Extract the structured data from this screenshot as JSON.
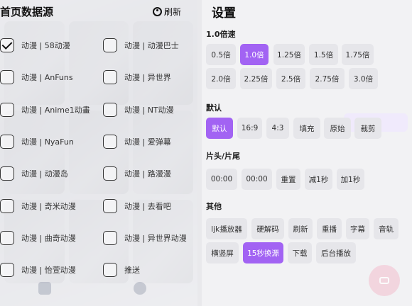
{
  "sources": {
    "title": "首页数据源",
    "refresh_label": "刷新",
    "items": [
      {
        "label": "动漫 | 58动漫",
        "checked": true
      },
      {
        "label": "动漫 | 动漫巴士",
        "checked": false
      },
      {
        "label": "动漫 | AnFuns",
        "checked": false
      },
      {
        "label": "动漫 | 异世界",
        "checked": false
      },
      {
        "label": "动漫 | Anime1动畫",
        "checked": false
      },
      {
        "label": "动漫 | NT动漫",
        "checked": false
      },
      {
        "label": "动漫 | NyaFun",
        "checked": false
      },
      {
        "label": "动漫 | 爱弹幕",
        "checked": false
      },
      {
        "label": "动漫 | 动漫岛",
        "checked": false
      },
      {
        "label": "动漫 | 路漫漫",
        "checked": false
      },
      {
        "label": "动漫 | 奇米动漫",
        "checked": false
      },
      {
        "label": "动漫 | 去看吧",
        "checked": false
      },
      {
        "label": "动漫 | 曲奇动漫",
        "checked": false
      },
      {
        "label": "动漫 | 异世界动漫",
        "checked": false
      },
      {
        "label": "动漫 | 怡萱动漫",
        "checked": false
      },
      {
        "label": "推送",
        "checked": false
      }
    ]
  },
  "settings": {
    "title": "设置",
    "speed": {
      "label": "1.0倍速",
      "options": [
        "0.5倍",
        "1.0倍",
        "1.25倍",
        "1.5倍",
        "1.75倍",
        "2.0倍",
        "2.25倍",
        "2.5倍",
        "2.75倍",
        "3.0倍"
      ],
      "selected": "1.0倍"
    },
    "aspect": {
      "label": "默认",
      "options": [
        "默认",
        "16:9",
        "4:3",
        "填充",
        "原始",
        "裁剪"
      ],
      "selected": "默认"
    },
    "skip": {
      "label": "片头/片尾",
      "options": [
        "00:00",
        "00:00",
        "重置",
        "减1秒",
        "加1秒"
      ]
    },
    "other": {
      "label": "其他",
      "options": [
        "ljk播放器",
        "硬解码",
        "刷新",
        "重播",
        "字幕",
        "音轨",
        "横竖屏",
        "15秒换源",
        "下载",
        "后台播放"
      ],
      "selected": "15秒换源"
    }
  },
  "colors": {
    "accent": "#a263f3",
    "chip_bg": "#e6e6ea"
  }
}
